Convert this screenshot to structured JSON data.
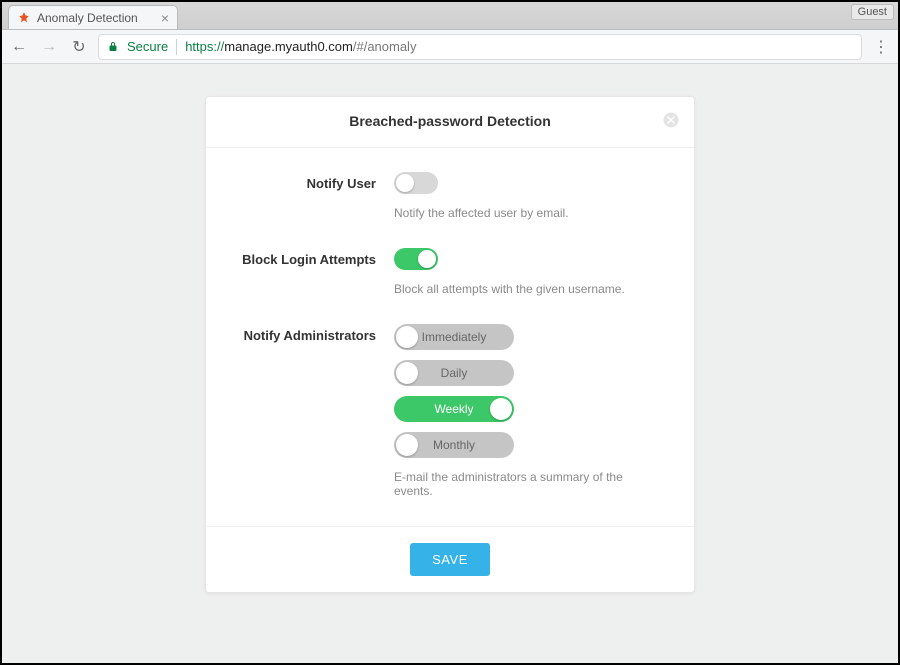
{
  "browser": {
    "tab_title": "Anomaly Detection",
    "guest_label": "Guest",
    "secure_label": "Secure",
    "url_protocol": "https://",
    "url_host": "manage.myauth0.com",
    "url_path": "/#/anomaly"
  },
  "dialog": {
    "title": "Breached-password Detection",
    "save_label": "SAVE",
    "notify_user": {
      "label": "Notify User",
      "enabled": false,
      "help": "Notify the affected user by email."
    },
    "block_login": {
      "label": "Block Login Attempts",
      "enabled": true,
      "help": "Block all attempts with the given username."
    },
    "notify_admins": {
      "label": "Notify Administrators",
      "help": "E-mail the administrators a summary of the events.",
      "options": [
        {
          "label": "Immediately",
          "selected": false
        },
        {
          "label": "Daily",
          "selected": false
        },
        {
          "label": "Weekly",
          "selected": true
        },
        {
          "label": "Monthly",
          "selected": false
        }
      ]
    }
  }
}
